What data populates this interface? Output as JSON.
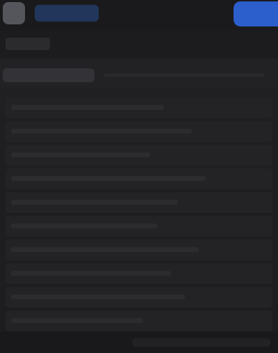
{
  "theme": {
    "background": "#1e1e20",
    "accent": "#2c5fcc",
    "title_pill": "#21365a"
  },
  "header": {
    "avatar_icon": "avatar-icon",
    "title": "",
    "action_label": ""
  },
  "list": {
    "rows": [
      "",
      "",
      "",
      "",
      "",
      "",
      "",
      "",
      "",
      ""
    ]
  }
}
